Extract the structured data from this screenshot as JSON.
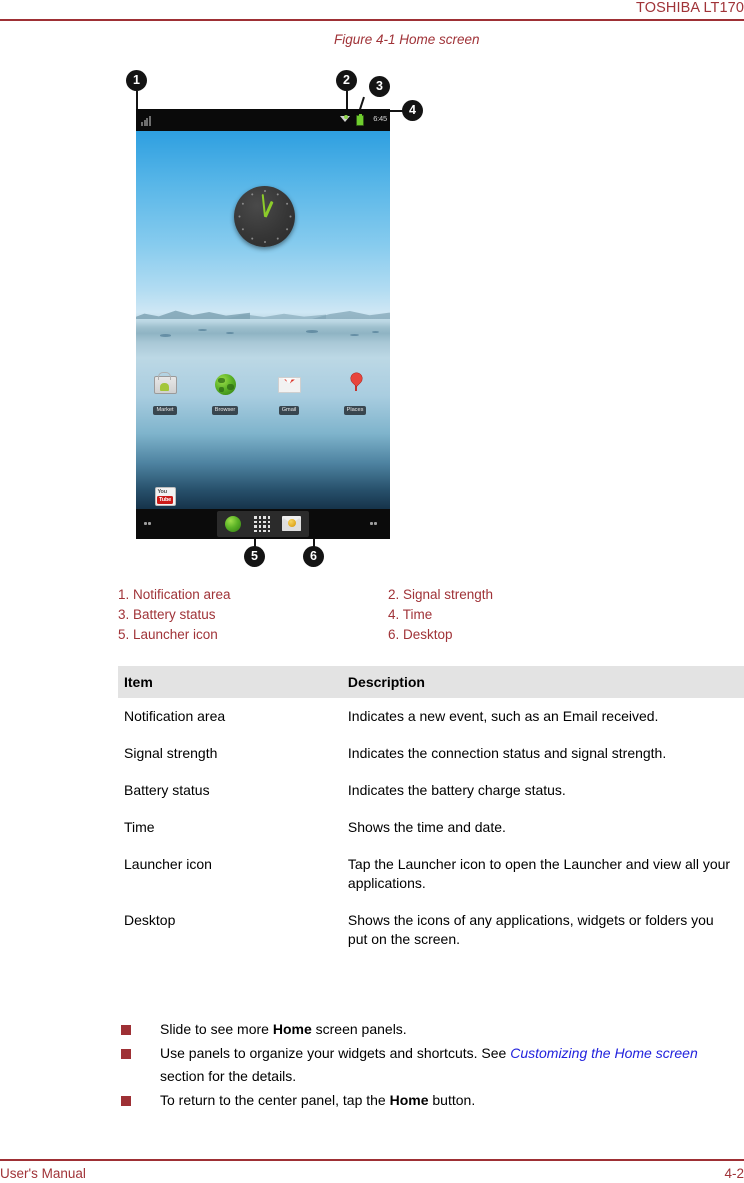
{
  "header": {
    "title": "TOSHIBA LT170"
  },
  "figure": {
    "caption": "Figure 4-1 Home screen",
    "callouts": [
      {
        "number": "1",
        "target": "notification-area"
      },
      {
        "number": "2",
        "target": "signal-strength"
      },
      {
        "number": "3",
        "target": "battery-status"
      },
      {
        "number": "4",
        "target": "time"
      },
      {
        "number": "5",
        "target": "launcher-icon"
      },
      {
        "number": "6",
        "target": "desktop"
      }
    ],
    "legend": [
      {
        "left": "1. Notification area",
        "right": "2. Signal strength"
      },
      {
        "left": "3. Battery status",
        "right": "4. Time"
      },
      {
        "left": "5. Launcher icon",
        "right": "6. Desktop"
      }
    ]
  },
  "device_screen": {
    "status_bar": {
      "notification_icon": "notification-bars-icon",
      "signal_icon": "signal-strength-icon",
      "battery_icon": "battery-icon",
      "time": "6:45"
    },
    "clock_widget": {
      "name": "analog-clock-widget"
    },
    "app_icons": [
      {
        "label": "Market",
        "icon": "market-icon"
      },
      {
        "label": "Browser",
        "icon": "browser-globe-icon"
      },
      {
        "label": "Gmail",
        "icon": "gmail-icon"
      },
      {
        "label": "Places",
        "icon": "places-pin-icon"
      },
      {
        "label": "YouTube",
        "icon": "youtube-icon"
      }
    ],
    "dock": {
      "browser_icon": "browser-globe-icon",
      "launcher_icon": "launcher-grid-icon",
      "email_icon": "email-icon"
    }
  },
  "table": {
    "headers": {
      "item": "Item",
      "description": "Description"
    },
    "rows": [
      {
        "item": "Notification area",
        "description": "Indicates a new event, such as an Email received."
      },
      {
        "item": "Signal strength",
        "description": "Indicates the connection status and signal strength."
      },
      {
        "item": "Battery status",
        "description": "Indicates the battery charge status."
      },
      {
        "item": "Time",
        "description": "Shows the time and date."
      },
      {
        "item": "Launcher icon",
        "description": "Tap the Launcher icon to open the Launcher and view all your applications."
      },
      {
        "item": "Desktop",
        "description": "Shows the icons of any applications, widgets or folders you put on the screen."
      }
    ]
  },
  "notes": [
    {
      "parts": [
        {
          "text": "Slide to see more ",
          "style": "normal"
        },
        {
          "text": "Home",
          "style": "bold"
        },
        {
          "text": " screen panels.",
          "style": "normal"
        }
      ]
    },
    {
      "parts": [
        {
          "text": "Use panels to organize your widgets and shortcuts. See ",
          "style": "normal"
        },
        {
          "text": "Customizing the Home screen",
          "style": "link"
        },
        {
          "text": " section for the details.",
          "style": "normal"
        }
      ]
    },
    {
      "parts": [
        {
          "text": "To return to the center panel, tap the ",
          "style": "normal"
        },
        {
          "text": "Home",
          "style": "bold"
        },
        {
          "text": " button.",
          "style": "normal"
        }
      ]
    }
  ],
  "footer": {
    "left": "User's Manual",
    "right": "4-2"
  },
  "colors": {
    "accent_red": "#a03338",
    "rule_red": "#9e3035",
    "link_blue": "#2222dd",
    "table_header_bg": "#e3e3e3"
  }
}
